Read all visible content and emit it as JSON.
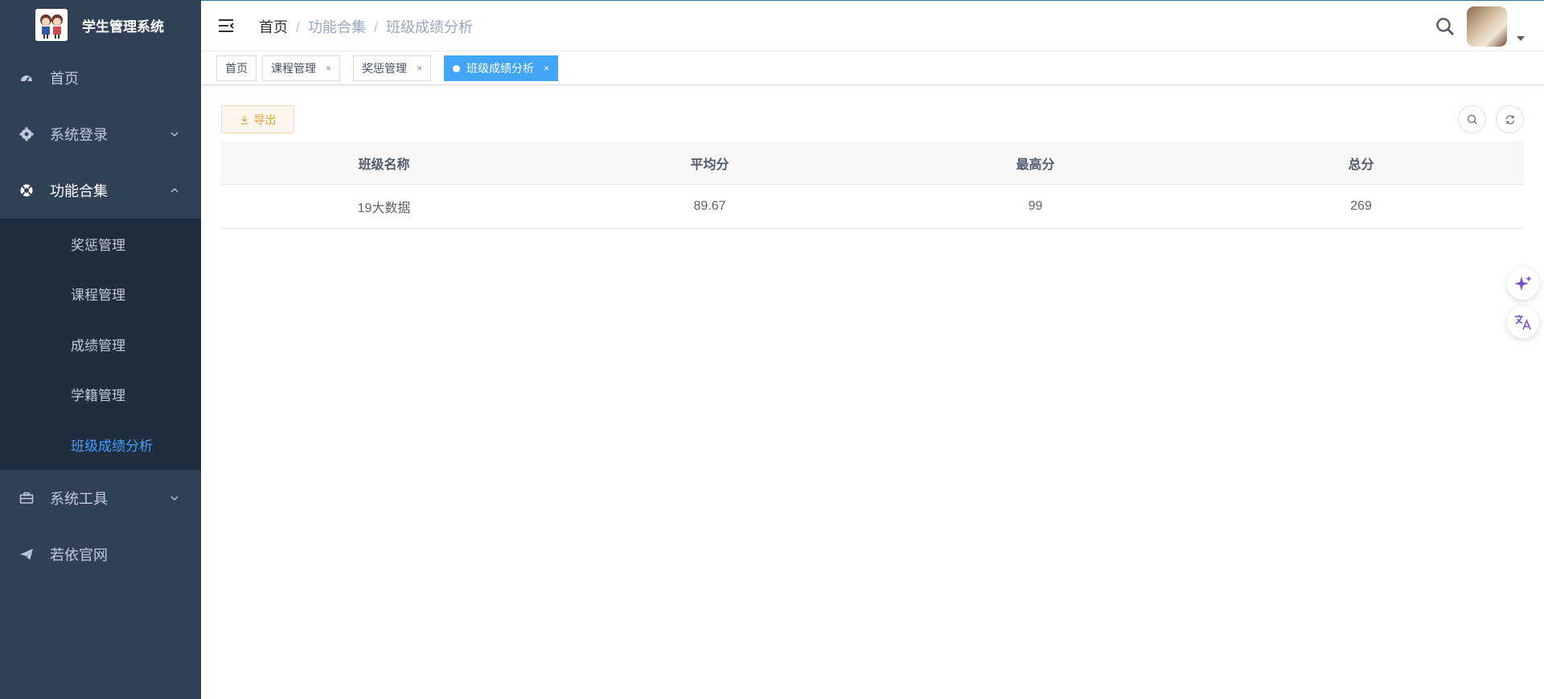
{
  "app": {
    "title": "学生管理系统"
  },
  "sidebar": {
    "items": [
      {
        "label": "首页",
        "icon": "dashboard-icon"
      },
      {
        "label": "系统登录",
        "icon": "gear-icon"
      },
      {
        "label": "功能合集",
        "icon": "lifebuoy-icon"
      },
      {
        "label": "系统工具",
        "icon": "toolbox-icon"
      },
      {
        "label": "若依官网",
        "icon": "send-icon"
      }
    ],
    "submenu": [
      {
        "label": "奖惩管理"
      },
      {
        "label": "课程管理"
      },
      {
        "label": "成绩管理"
      },
      {
        "label": "学籍管理"
      },
      {
        "label": "班级成绩分析",
        "active": true
      }
    ]
  },
  "breadcrumb": [
    "首页",
    "功能合集",
    "班级成绩分析"
  ],
  "tags": [
    {
      "label": "首页"
    },
    {
      "label": "课程管理"
    },
    {
      "label": "奖惩管理"
    },
    {
      "label": "班级成绩分析",
      "active": true
    }
  ],
  "toolbar": {
    "export_label": "导出"
  },
  "table": {
    "columns": [
      "班级名称",
      "平均分",
      "最高分",
      "总分"
    ],
    "rows": [
      [
        "19大数据",
        "89.67",
        "99",
        "269"
      ]
    ]
  },
  "colors": {
    "sidebar_bg": "#304156",
    "submenu_bg": "#1f2d3d",
    "active": "#409eff",
    "tag_active": "#42a5f5",
    "warning": "#e6a23c"
  }
}
